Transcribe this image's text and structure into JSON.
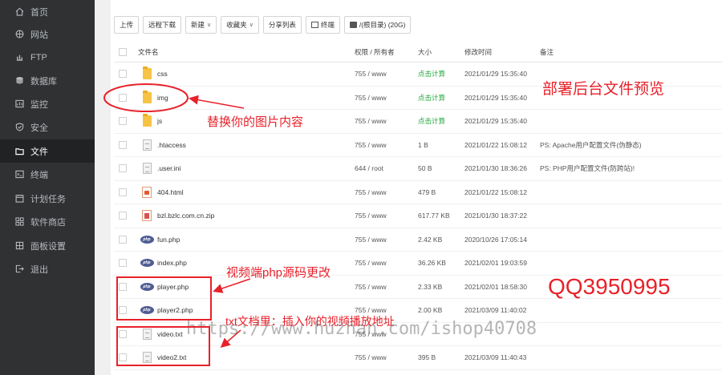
{
  "sidebar": {
    "items": [
      {
        "label": "首页",
        "icon": "home-icon"
      },
      {
        "label": "网站",
        "icon": "globe-icon"
      },
      {
        "label": "FTP",
        "icon": "ftp-icon"
      },
      {
        "label": "数据库",
        "icon": "database-icon"
      },
      {
        "label": "监控",
        "icon": "monitor-icon"
      },
      {
        "label": "安全",
        "icon": "shield-icon"
      },
      {
        "label": "文件",
        "icon": "folder-icon",
        "active": true
      },
      {
        "label": "终端",
        "icon": "terminal-icon"
      },
      {
        "label": "计划任务",
        "icon": "calendar-icon"
      },
      {
        "label": "软件商店",
        "icon": "grid-icon"
      },
      {
        "label": "面板设置",
        "icon": "gear-icon"
      },
      {
        "label": "退出",
        "icon": "logout-icon"
      }
    ]
  },
  "toolbar": {
    "upload": "上传",
    "remote_download": "远程下载",
    "new": "新建",
    "favorites": "收藏夹",
    "share_list": "分享列表",
    "terminal": "终端",
    "root_dir": "/(根目录) (20G)"
  },
  "table": {
    "headers": {
      "name": "文件名",
      "perm": "权限 / 所有者",
      "size": "大小",
      "mtime": "修改时间",
      "note": "备注"
    },
    "rows": [
      {
        "icon": "folder",
        "name": "css",
        "perm": "755 / www",
        "size": "点击计算",
        "mtime": "2021/01/29 15:35:40",
        "note": ""
      },
      {
        "icon": "folder",
        "name": "img",
        "perm": "755 / www",
        "size": "点击计算",
        "mtime": "2021/01/29 15:35:40",
        "note": ""
      },
      {
        "icon": "folder",
        "name": "js",
        "perm": "755 / www",
        "size": "点击计算",
        "mtime": "2021/01/29 15:35:40",
        "note": ""
      },
      {
        "icon": "doc",
        "name": ".htaccess",
        "perm": "755 / www",
        "size": "1 B",
        "mtime": "2021/01/22 15:08:12",
        "note": "PS: Apache用户配置文件(伪静态)"
      },
      {
        "icon": "doc",
        "name": ".user.ini",
        "perm": "644 / root",
        "size": "50 B",
        "mtime": "2021/01/30 18:36:26",
        "note": "PS: PHP用户配置文件(防跨站)!"
      },
      {
        "icon": "html",
        "name": "404.html",
        "perm": "755 / www",
        "size": "479 B",
        "mtime": "2021/01/22 15:08:12",
        "note": ""
      },
      {
        "icon": "zip",
        "name": "bzl.bzlc.com.cn.zip",
        "perm": "755 / www",
        "size": "617.77 KB",
        "mtime": "2021/01/30 18:37:22",
        "note": ""
      },
      {
        "icon": "php",
        "name": "fun.php",
        "perm": "755 / www",
        "size": "2.42 KB",
        "mtime": "2020/10/26 17:05:14",
        "note": ""
      },
      {
        "icon": "php",
        "name": "index.php",
        "perm": "755 / www",
        "size": "36.26 KB",
        "mtime": "2021/02/01 19:03:59",
        "note": ""
      },
      {
        "icon": "php",
        "name": "player.php",
        "perm": "755 / www",
        "size": "2.33 KB",
        "mtime": "2021/02/01 18:58:30",
        "note": ""
      },
      {
        "icon": "php",
        "name": "player2.php",
        "perm": "755 / www",
        "size": "2.00 KB",
        "mtime": "2021/03/09 11:40:02",
        "note": ""
      },
      {
        "icon": "doc",
        "name": "video.txt",
        "perm": "755 / www",
        "size": "",
        "mtime": "",
        "note": ""
      },
      {
        "icon": "doc",
        "name": "video2.txt",
        "perm": "755 / www",
        "size": "395 B",
        "mtime": "2021/03/09 11:40:43",
        "note": ""
      }
    ]
  },
  "annotations": {
    "preview": "部署后台文件预览",
    "replace_images": "替换你的图片内容",
    "php_change": "视频端php源码更改",
    "qq": "QQ3950995",
    "txt_hint": "txt文档里：插入你的视频播放地址",
    "watermark": "https://www.huzhan.com/ishop40708"
  },
  "colors": {
    "sidebar_bg": "#2f3133",
    "accent_green": "#20a53a",
    "annotation_red": "#e8212a"
  }
}
